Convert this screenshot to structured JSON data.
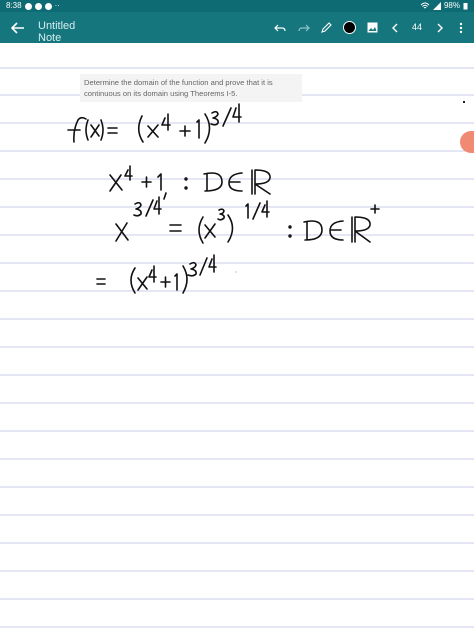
{
  "status": {
    "time": "8:38",
    "battery": "98%"
  },
  "toolbar": {
    "title": "Untitled Note",
    "page": "44"
  },
  "question": {
    "text": "Determine the domain of the function and prove that it is continuous on its domain using Theorems I-5."
  },
  "colors": {
    "toolbar": "#15767e",
    "statusbar": "#0f6b73",
    "ruled_line": "#c9cde8",
    "ink": "#111111"
  },
  "icons": [
    "back-arrow-icon",
    "undo-icon",
    "redo-icon",
    "pen-icon",
    "color-dot-icon",
    "image-icon",
    "chevron-left-icon",
    "chevron-right-icon",
    "more-vert-icon"
  ]
}
